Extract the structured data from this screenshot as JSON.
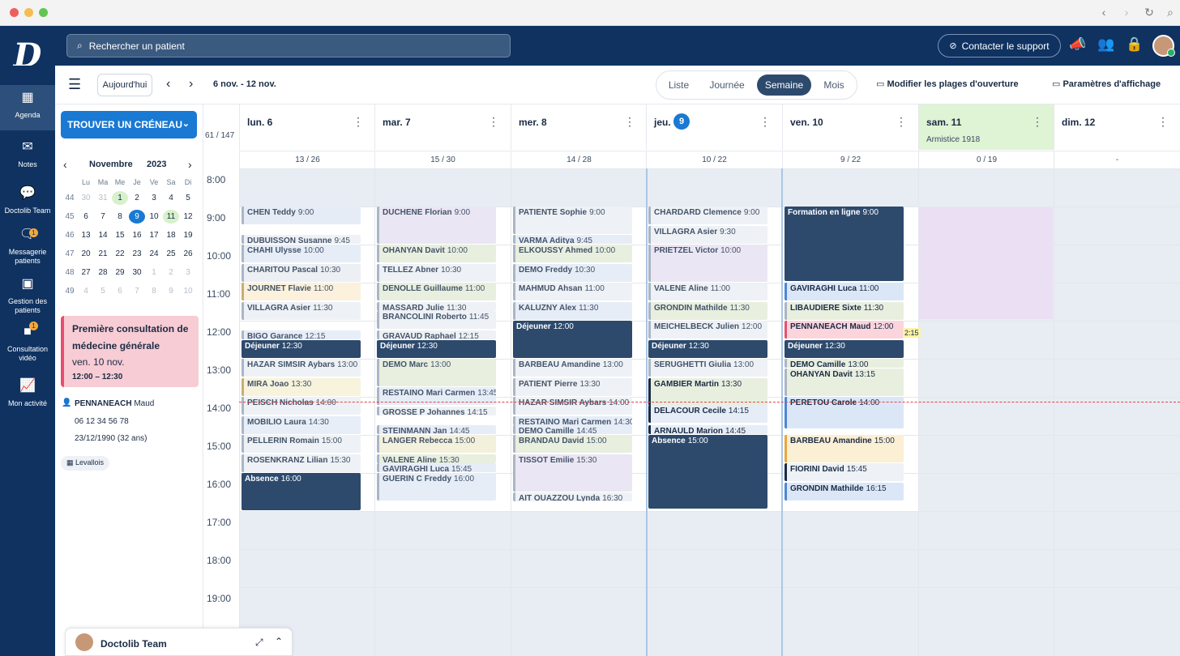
{
  "chrome": {
    "colors": [
      "#ee5f5b",
      "#f5bd4f",
      "#61c554"
    ]
  },
  "app": {
    "logo": "D"
  },
  "search": {
    "placeholder": "Rechercher un patient"
  },
  "support": {
    "label": "Contacter le support"
  },
  "sidebar": {
    "items": [
      {
        "label": "Agenda",
        "icon": "calendar-icon"
      },
      {
        "label": "Notes",
        "icon": "mail-icon"
      },
      {
        "label": "Doctolib Team",
        "icon": "chat-icon"
      },
      {
        "label": "Messagerie patients",
        "icon": "message-icon",
        "badge": "1"
      },
      {
        "label": "Gestion des patients",
        "icon": "patient-file-icon"
      },
      {
        "label": "Consultation vidéo",
        "icon": "video-icon",
        "badge": "1"
      },
      {
        "label": "Mon activité",
        "icon": "chart-icon"
      }
    ]
  },
  "toolbar": {
    "today": "Aujourd'hui",
    "range": "6 nov. - 12 nov.",
    "views": [
      "Liste",
      "Journée",
      "Semaine",
      "Mois"
    ],
    "active_view": "Semaine",
    "edit_hours": "Modifier les plages d'ouverture",
    "display_settings": "Paramètres d'affichage"
  },
  "find_slot": "TROUVER UN CRÉNEAU",
  "mini_calendar": {
    "month": "Novembre",
    "year": "2023",
    "weekdays": [
      "Lu",
      "Ma",
      "Me",
      "Je",
      "Ve",
      "Sa",
      "Di"
    ],
    "weeks": [
      {
        "wk": "44",
        "days": [
          "30",
          "31",
          "1",
          "2",
          "3",
          "4",
          "5"
        ]
      },
      {
        "wk": "45",
        "days": [
          "6",
          "7",
          "8",
          "9",
          "10",
          "11",
          "12"
        ]
      },
      {
        "wk": "46",
        "days": [
          "13",
          "14",
          "15",
          "16",
          "17",
          "18",
          "19"
        ]
      },
      {
        "wk": "47",
        "days": [
          "20",
          "21",
          "22",
          "23",
          "24",
          "25",
          "26"
        ]
      },
      {
        "wk": "48",
        "days": [
          "27",
          "28",
          "29",
          "30",
          "1",
          "2",
          "3"
        ]
      },
      {
        "wk": "49",
        "days": [
          "4",
          "5",
          "6",
          "7",
          "8",
          "9",
          "10"
        ]
      }
    ]
  },
  "selected_appointment": {
    "title": "Première consultation de médecine générale",
    "date": "ven. 10 nov.",
    "time": "12:00 – 12:30",
    "patient_last": "PENNANEACH",
    "patient_first": "Maud",
    "phone": "06 12 34 56 78",
    "birth": "23/12/1990 (32 ans)",
    "location": "Levallois"
  },
  "week": {
    "total": "61 / 147",
    "days": [
      {
        "label": "lun. 6",
        "count": "13 / 26",
        "sub": ""
      },
      {
        "label": "mar. 7",
        "count": "15 / 30",
        "sub": ""
      },
      {
        "label": "mer. 8",
        "count": "14 / 28",
        "sub": ""
      },
      {
        "label": "jeu.",
        "num": "9",
        "count": "10 / 22",
        "sub": ""
      },
      {
        "label": "ven. 10",
        "count": "9 / 22",
        "sub": ""
      },
      {
        "label": "sam. 11",
        "count": "0 / 19",
        "sub": "Armistice 1918"
      },
      {
        "label": "dim. 12",
        "count": "-",
        "sub": ""
      }
    ],
    "hours": [
      "8:00",
      "9:00",
      "10:00",
      "11:00",
      "12:00",
      "13:00",
      "14:00",
      "15:00",
      "16:00",
      "17:00",
      "18:00",
      "19:00"
    ]
  },
  "events": {
    "mon": [
      {
        "name": "CHEN Teddy",
        "time": "9:00"
      },
      {
        "name": "DUBUISSON Susanne",
        "time": "9:45"
      },
      {
        "name": "CHAHI Ulysse",
        "time": "10:00"
      },
      {
        "name": "CHARITOU Pascal",
        "time": "10:30"
      },
      {
        "name": "JOURNET Flavie",
        "time": "11:00"
      },
      {
        "name": "VILLAGRA Asier",
        "time": "11:30"
      },
      {
        "name": "BIGO Garance",
        "time": "12:15"
      },
      {
        "name": "Déjeuner",
        "time": "12:30"
      },
      {
        "name": "HAZAR SIMSIR Aybars",
        "time": "13:00"
      },
      {
        "name": "MIRA Joao",
        "time": "13:30"
      },
      {
        "name": "PEISCH Nicholas",
        "time": "14:00"
      },
      {
        "name": "MOBILIO Laura",
        "time": "14:30"
      },
      {
        "name": "PELLERIN Romain",
        "time": "15:00"
      },
      {
        "name": "ROSENKRANZ Lilian",
        "time": "15:30"
      },
      {
        "name": "Absence",
        "time": "16:00"
      }
    ],
    "tue": [
      {
        "name": "DUCHENE Florian",
        "time": "9:00"
      },
      {
        "name": "OHANYAN Davit",
        "time": "10:00"
      },
      {
        "name": "TELLEZ Abner",
        "time": "10:30"
      },
      {
        "name": "DENOLLE Guillaume",
        "time": "11:00"
      },
      {
        "name": "MASSARD Julie",
        "time": "11:30"
      },
      {
        "name": "BRANCOLINI Roberto",
        "time": "11:45"
      },
      {
        "name": "GRAVAUD Raphael",
        "time": "12:15"
      },
      {
        "name": "Déjeuner",
        "time": "12:30"
      },
      {
        "name": "DEMO Marc",
        "time": "13:00"
      },
      {
        "name": "RESTAINO Mari Carmen",
        "time": "13:45"
      },
      {
        "name": "GROSSE P Johannes",
        "time": "14:15"
      },
      {
        "name": "STEINMANN Jan",
        "time": "14:45"
      },
      {
        "name": "LANGER Rebecca",
        "time": "15:00"
      },
      {
        "name": "VALENE Aline",
        "time": "15:30"
      },
      {
        "name": "GAVIRAGHI Luca",
        "time": "15:45"
      },
      {
        "name": "GUERIN C Freddy",
        "time": "16:00"
      }
    ],
    "wed": [
      {
        "name": "PATIENTE Sophie",
        "time": "9:00"
      },
      {
        "name": "VARMA Aditya",
        "time": "9:45"
      },
      {
        "name": "ELKOUSSY Ahmed",
        "time": "10:00"
      },
      {
        "name": "DEMO Freddy",
        "time": "10:30"
      },
      {
        "name": "MAHMUD Ahsan",
        "time": "11:00"
      },
      {
        "name": "KALUZNY Alex",
        "time": "11:30"
      },
      {
        "name": "Déjeuner",
        "time": "12:00"
      },
      {
        "name": "BARBEAU Amandine",
        "time": "13:00"
      },
      {
        "name": "PATIENT Pierre",
        "time": "13:30"
      },
      {
        "name": "HAZAR SIMSIR Aybars",
        "time": "14:00"
      },
      {
        "name": "RESTAINO Mari Carmen",
        "time": "14:30"
      },
      {
        "name": "DEMO Camille",
        "time": "14:45"
      },
      {
        "name": "BRANDAU David",
        "time": "15:00"
      },
      {
        "name": "TISSOT Emilie",
        "time": "15:30"
      },
      {
        "name": "AIT OUAZZOU Lynda",
        "time": "16:30"
      }
    ],
    "thu": [
      {
        "name": "CHARDARD Clemence",
        "time": "9:00"
      },
      {
        "name": "VILLAGRA Asier",
        "time": "9:30"
      },
      {
        "name": "PRIETZEL Victor",
        "time": "10:00"
      },
      {
        "name": "VALENE Aline",
        "time": "11:00"
      },
      {
        "name": "GRONDIN Mathilde",
        "time": "11:30"
      },
      {
        "name": "MEICHELBECK Julien",
        "time": "12:00"
      },
      {
        "name": "Déjeuner",
        "time": "12:30"
      },
      {
        "name": "SERUGHETTI Giulia",
        "time": "13:00"
      },
      {
        "name": "GAMBIER Martin",
        "time": "13:30"
      },
      {
        "name": "DELACOUR Cecile",
        "time": "14:15"
      },
      {
        "name": "ARNAULD Marion",
        "time": "14:45"
      },
      {
        "name": "Absence",
        "time": "15:00"
      }
    ],
    "fri": [
      {
        "name": "Formation en ligne",
        "time": "9:00"
      },
      {
        "name": "GAVIRAGHI Luca",
        "time": "11:00"
      },
      {
        "name": "LIBAUDIERE Sixte",
        "time": "11:30"
      },
      {
        "name": "PENNANEACH Maud",
        "time": "12:00"
      },
      {
        "name": "Déjeuner",
        "time": "12:30"
      },
      {
        "name": "DEMO Camille",
        "time": "13:00"
      },
      {
        "name": "OHANYAN Davit",
        "time": "13:15"
      },
      {
        "name": "PERETOU Carole",
        "time": "14:00"
      },
      {
        "name": "BARBEAU Amandine",
        "time": "15:00"
      },
      {
        "name": "FIORINI David",
        "time": "15:45"
      },
      {
        "name": "GRONDIN Mathilde",
        "time": "16:15"
      }
    ],
    "overflow": "2:15"
  },
  "chat": {
    "name": "Doctolib Team"
  }
}
